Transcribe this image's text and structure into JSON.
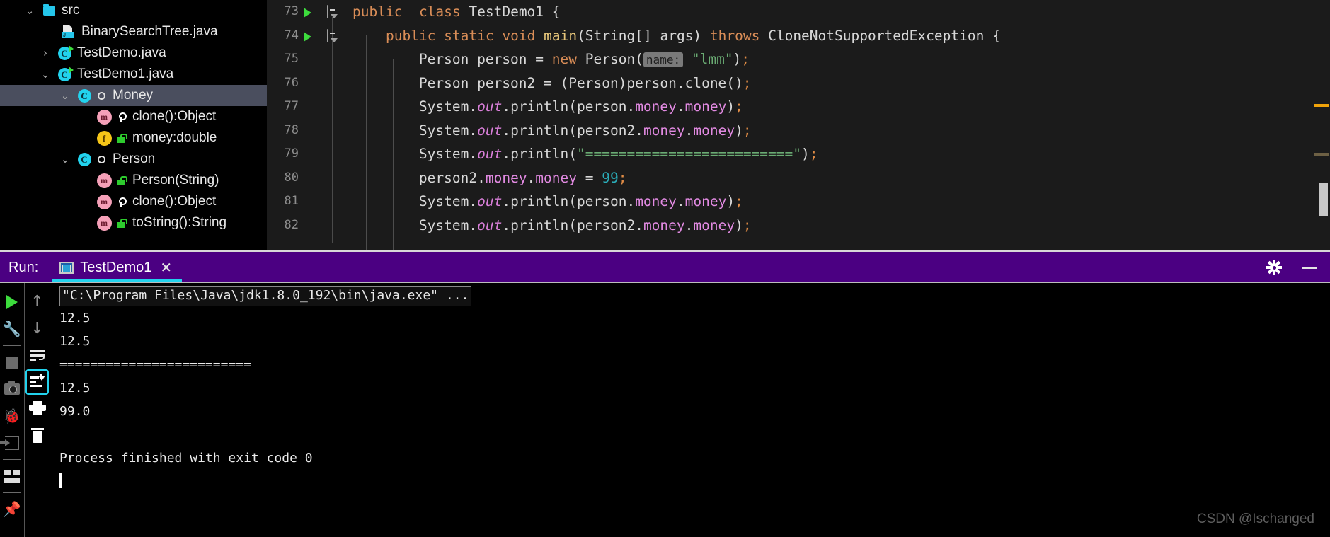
{
  "tree": {
    "items": [
      {
        "label": "src",
        "icon": "folder-icon",
        "chevron": "⌄",
        "indent": 28,
        "vis": "",
        "selected": false
      },
      {
        "label": "BinarySearchTree.java",
        "icon": "java-file-icon",
        "chevron": "",
        "indent": 84,
        "vis": "",
        "selected": false
      },
      {
        "label": "TestDemo.java",
        "icon": "class-runnable-icon",
        "chevron": "›",
        "indent": 50,
        "vis": "",
        "selected": false
      },
      {
        "label": "TestDemo1.java",
        "icon": "class-runnable-icon",
        "chevron": "⌄",
        "indent": 50,
        "vis": "",
        "selected": false
      },
      {
        "label": "Money",
        "icon": "class-icon",
        "chevron": "⌄",
        "indent": 78,
        "vis": "public",
        "selected": true
      },
      {
        "label": "clone():Object",
        "icon": "method-icon",
        "chevron": "",
        "indent": 134,
        "vis": "protected",
        "selected": false
      },
      {
        "label": "money:double",
        "icon": "field-icon",
        "chevron": "",
        "indent": 134,
        "vis": "default",
        "selected": false
      },
      {
        "label": "Person",
        "icon": "class-icon",
        "chevron": "⌄",
        "indent": 78,
        "vis": "public",
        "selected": false
      },
      {
        "label": "Person(String)",
        "icon": "method-icon",
        "chevron": "",
        "indent": 134,
        "vis": "default",
        "selected": false
      },
      {
        "label": "clone():Object",
        "icon": "method-icon",
        "chevron": "",
        "indent": 134,
        "vis": "protected",
        "selected": false
      },
      {
        "label": "toString():String",
        "icon": "method-icon",
        "chevron": "",
        "indent": 134,
        "vis": "default",
        "selected": false
      }
    ]
  },
  "editor": {
    "lines": [
      {
        "num": "73",
        "runnable": true,
        "fold": "start",
        "indent": 0
      },
      {
        "num": "74",
        "runnable": true,
        "fold": "start",
        "indent": 1
      },
      {
        "num": "75",
        "runnable": false,
        "fold": "",
        "indent": 2
      },
      {
        "num": "76",
        "runnable": false,
        "fold": "",
        "indent": 2
      },
      {
        "num": "77",
        "runnable": false,
        "fold": "",
        "indent": 2
      },
      {
        "num": "78",
        "runnable": false,
        "fold": "",
        "indent": 2
      },
      {
        "num": "79",
        "runnable": false,
        "fold": "",
        "indent": 2
      },
      {
        "num": "80",
        "runnable": false,
        "fold": "",
        "indent": 2
      },
      {
        "num": "81",
        "runnable": false,
        "fold": "",
        "indent": 2
      },
      {
        "num": "82",
        "runnable": false,
        "fold": "",
        "indent": 2
      }
    ],
    "code": {
      "l73": "public  class TestDemo1 {",
      "l74": "    public static void main(String[] args) throws CloneNotSupportedException {",
      "l75": "        Person person = new Person( name: \"lmm\");",
      "l75_hint": "name:",
      "l76": "        Person person2 = (Person)person.clone();",
      "l77": "        System.out.println(person.money.money);",
      "l78": "        System.out.println(person2.money.money);",
      "l79": "        System.out.println(\"=========================\");",
      "l80": "        person2.money.money = 99;",
      "l81": "        System.out.println(person.money.money);",
      "l82": "        System.out.println(person2.money.money);"
    }
  },
  "run_panel": {
    "label": "Run:",
    "tab": {
      "title": "TestDemo1",
      "close": "✕"
    },
    "header_icons": [
      "gear-icon",
      "minimize-icon"
    ],
    "left_toolbar": [
      "rerun-icon",
      "edit-configurations-icon",
      "stop-icon",
      "screenshot-icon",
      "dump-threads-icon",
      "restore-layout-icon",
      "layout-icon",
      "pin-tab-icon"
    ],
    "right_toolbar": [
      "scroll-up-icon",
      "scroll-down-icon",
      "soft-wrap-icon",
      "scroll-to-end-icon",
      "print-icon",
      "clear-all-icon"
    ],
    "console": {
      "command": "\"C:\\Program Files\\Java\\jdk1.8.0_192\\bin\\java.exe\" ...",
      "output": [
        "12.5",
        "12.5",
        "=========================",
        "12.5",
        "99.0",
        "",
        "Process finished with exit code 0"
      ]
    }
  },
  "watermark": "CSDN @Ischanged",
  "colors": {
    "run_header_purple": "#4b0082",
    "tab_underline_cyan": "#22d3ee",
    "selection": "#4a4e5e",
    "editor_bg": "#1b1b1b",
    "keyword": "#d98d57",
    "string": "#6aab73",
    "number": "#2aacb8",
    "field": "#e28ae2",
    "method": "#e8c77b",
    "warn_marker": "#f0a30a"
  }
}
